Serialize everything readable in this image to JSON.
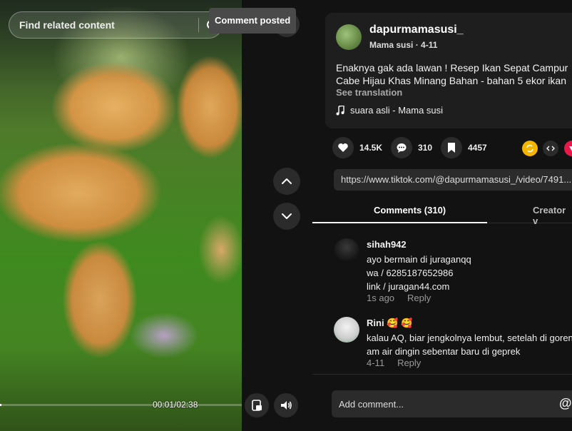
{
  "video": {
    "search_placeholder": "Find related content",
    "toast": "Comment posted",
    "time": "00:01/02:38",
    "progress": 0.006
  },
  "post": {
    "username": "dapurmamasusi_",
    "display_name": "Mama susi",
    "date": "4-11",
    "separator": " · ",
    "caption": "Enaknya gak ada lawan ! Resep Ikan Sepat Campur Cabe Hijau Khas Minang Bahan - bahan 5 ekor ikan",
    "see_translation": "See translation",
    "music": "suara asli - Mama susi"
  },
  "actions": {
    "likes": "14.5K",
    "comments": "310",
    "saves": "4457"
  },
  "link": "https://www.tiktok.com/@dapurmamasusi_/video/7491...",
  "tabs": {
    "comments": "Comments (310)",
    "creator": "Creator v"
  },
  "comments": [
    {
      "name": "sihah942",
      "lines": [
        "ayo bermain di juraganqq",
        "wa / 6285187652986",
        "link / juragan44.com"
      ],
      "time": "1s ago",
      "reply": "Reply"
    },
    {
      "name": "Rini 🥰 🥰",
      "lines": [
        "kalau AQ, biar jengkolnya lembut, setelah di goren",
        "am air dingin sebentar baru di geprek"
      ],
      "time": "4-11",
      "reply": "Reply"
    }
  ],
  "add_comment_placeholder": "Add comment...",
  "at_symbol": "@",
  "colors": {
    "background": "#121212",
    "card": "#1e1e1e",
    "button": "#2b2b2b",
    "repost": "#f5b400",
    "pinterest": "#e6194b"
  },
  "icons": [
    "search-icon",
    "chevron-up-icon",
    "chevron-down-icon",
    "heart-icon",
    "comment-icon",
    "bookmark-icon",
    "repost-icon",
    "embed-icon",
    "share-icon",
    "music-note-icon",
    "pip-icon",
    "volume-icon"
  ]
}
